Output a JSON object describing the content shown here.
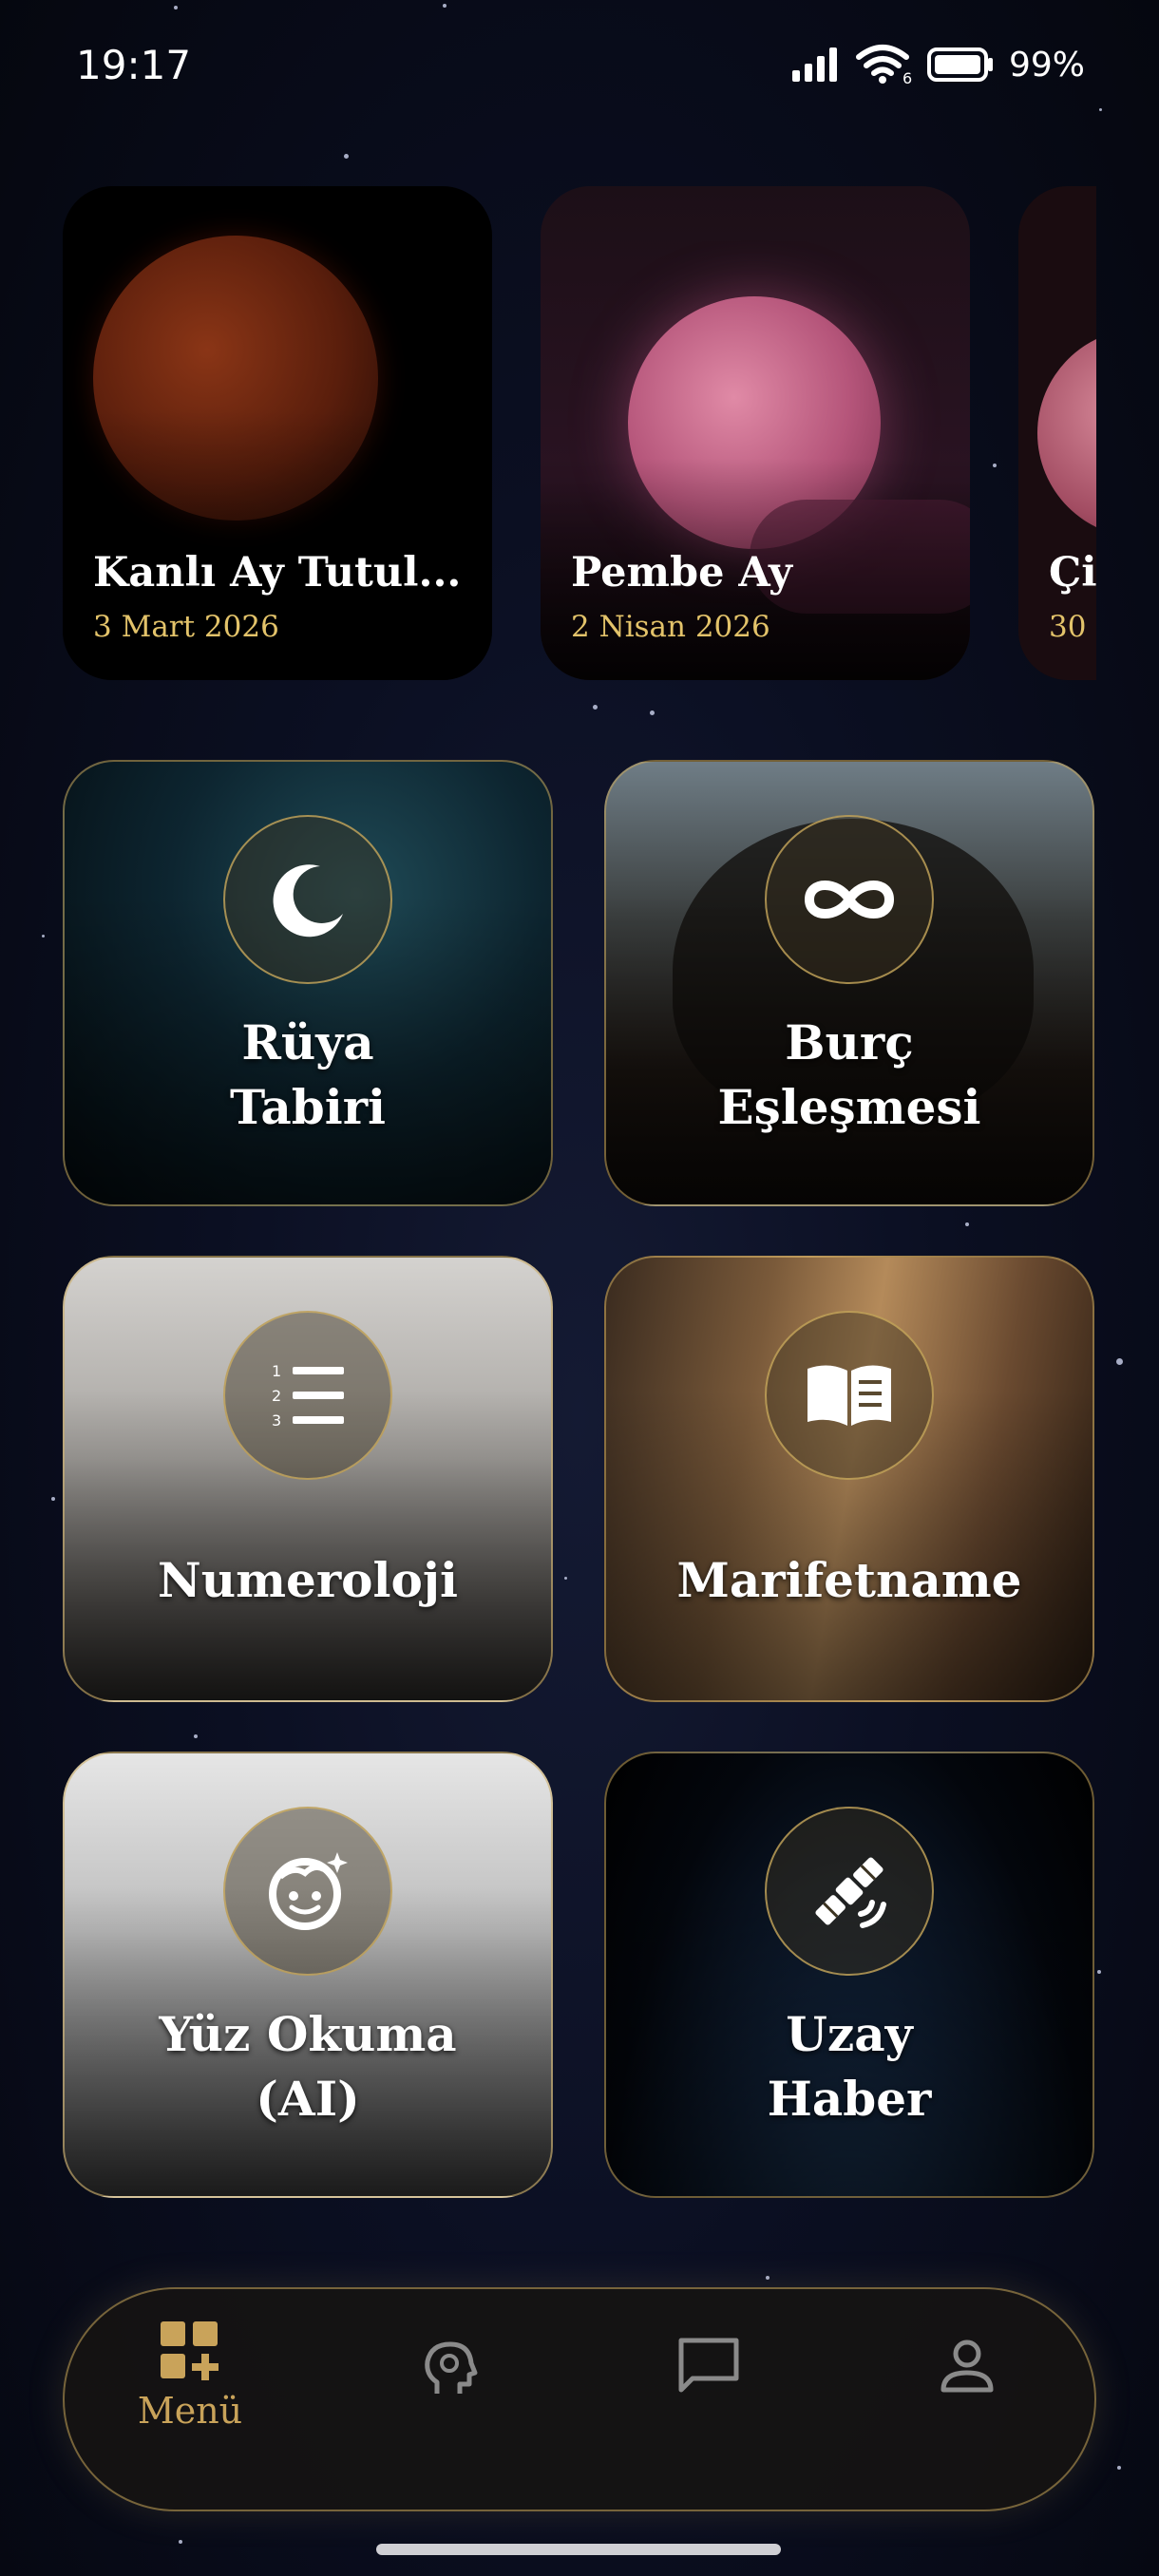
{
  "status_bar": {
    "time": "19:17",
    "battery": "99%",
    "wifi_badge": "6",
    "icons": [
      "signal-icon",
      "wifi-icon",
      "battery-icon"
    ]
  },
  "events": [
    {
      "title": "Kanlı Ay Tutul...",
      "date": "3 Mart 2026",
      "moon": "blood-moon"
    },
    {
      "title": "Pembe Ay",
      "date": "2 Nisan 2026",
      "moon": "pink-moon"
    },
    {
      "title": "Çil",
      "date": "30",
      "moon": "partial-moon"
    }
  ],
  "tiles": [
    {
      "line1": "Rüya",
      "line2": "Tabiri",
      "icon": "moon-icon"
    },
    {
      "line1": "Burç",
      "line2": "Eşleşmesi",
      "icon": "infinity-icon"
    },
    {
      "line1": "Numeroloji",
      "line2": "",
      "icon": "numbered-list-icon"
    },
    {
      "line1": "Marifetname",
      "line2": "",
      "icon": "open-book-icon"
    },
    {
      "line1": "Yüz Okuma",
      "line2": "(AI)",
      "icon": "face-sparkle-icon"
    },
    {
      "line1": "Uzay",
      "line2": "Haber",
      "icon": "satellite-icon"
    }
  ],
  "nav": {
    "menu_label": "Menü",
    "active": "menu",
    "items": [
      "menu-icon",
      "psychic-head-icon",
      "chat-icon",
      "profile-icon"
    ]
  },
  "colors": {
    "accent": "#c9a35a",
    "date": "#e3c36a",
    "background": "#0b0f22"
  }
}
